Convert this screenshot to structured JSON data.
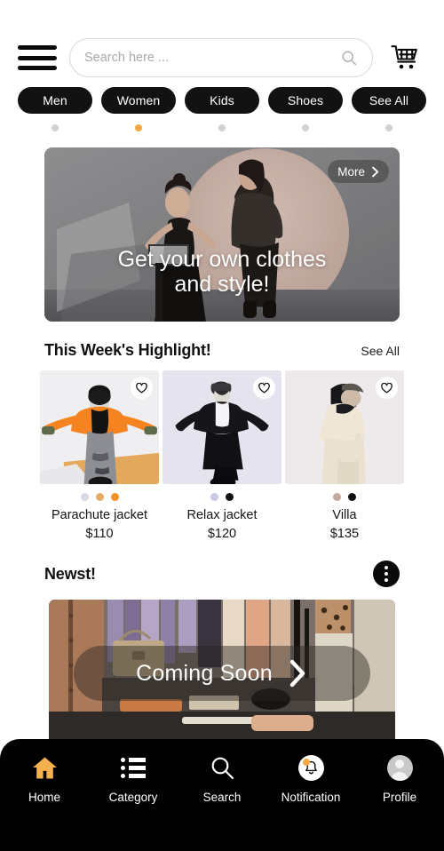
{
  "header": {
    "menu_icon": "hamburger-menu-icon",
    "search": {
      "placeholder": "Search here ...",
      "value": "",
      "icon": "search-icon"
    },
    "cart_icon": "shopping-cart-icon"
  },
  "categories": {
    "items": [
      {
        "label": "Men",
        "dot_active": false
      },
      {
        "label": "Women",
        "dot_active": true
      },
      {
        "label": "Kids",
        "dot_active": false
      },
      {
        "label": "Shoes",
        "dot_active": false
      },
      {
        "label": "See All",
        "dot_active": false
      }
    ],
    "dot_active_color": "#f5a940",
    "dot_inactive_color": "#d2d2d2"
  },
  "hero": {
    "title_line1": "Get your own clothes",
    "title_line2": "and style!",
    "more_label": "More",
    "more_icon": "chevron-right-icon",
    "alt": "two fashion models in black outfits in a gray studio with a beige circular backdrop"
  },
  "highlight": {
    "title": "This Week's Highlight!",
    "see_all": "See All",
    "products": [
      {
        "name": "Parachute jacket",
        "price": "$110",
        "heart_icon": "heart-outline-icon",
        "swatches": [
          "#d7dae2",
          "#e7ab63",
          "#f49227"
        ],
        "alt": "model in orange puffer jacket, black beanie and gray ripped jeans"
      },
      {
        "name": "Relax jacket",
        "price": "$120",
        "heart_icon": "heart-outline-icon",
        "swatches": [
          "#c9cbe4",
          "#111111"
        ],
        "alt": "model in oversized black jacket, white shirt and black wide pants"
      },
      {
        "name": "Villa",
        "price": "$135",
        "heart_icon": "heart-outline-icon",
        "swatches": [
          "#c4ab9e",
          "#111111"
        ],
        "alt": "model in cream suit with black hood"
      }
    ]
  },
  "newest": {
    "title": "Newst!",
    "menu_icon": "kebab-menu-icon",
    "banner": {
      "label": "Coming Soon",
      "arrow_icon": "chevron-right-icon",
      "alt": "boutique clothing store interior with racks of garments and handbags"
    }
  },
  "bottom_nav": {
    "items": [
      {
        "label": "Home",
        "icon": "home-icon",
        "active": true
      },
      {
        "label": "Category",
        "icon": "list-icon",
        "active": false
      },
      {
        "label": "Search",
        "icon": "search-icon",
        "active": false
      },
      {
        "label": "Notification",
        "icon": "bell-icon",
        "active": false,
        "badge": true
      },
      {
        "label": "Profile",
        "icon": "user-avatar-icon",
        "active": false
      }
    ],
    "active_color": "#f5b04e",
    "background": "#000000"
  }
}
